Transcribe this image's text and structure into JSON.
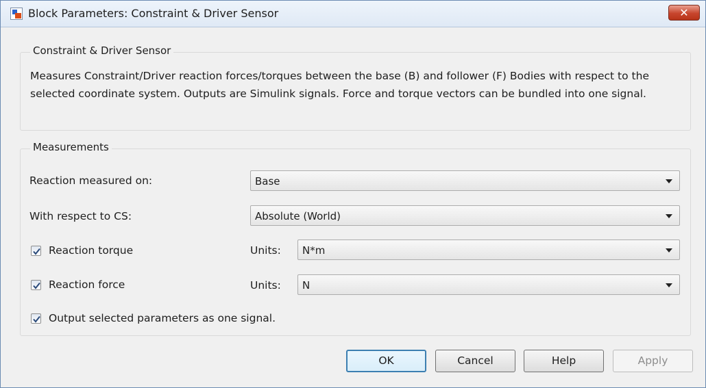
{
  "window": {
    "title": "Block Parameters: Constraint & Driver Sensor",
    "close_label": "✕"
  },
  "description_group": {
    "title": "Constraint & Driver Sensor",
    "text": "Measures Constraint/Driver reaction forces/torques between the base (B) and follower (F) Bodies with respect to the selected coordinate system. Outputs are Simulink signals. Force and torque vectors can be bundled into one signal."
  },
  "measurements": {
    "title": "Measurements",
    "reaction_measured_on": {
      "label": "Reaction measured on:",
      "value": "Base"
    },
    "with_respect_to_cs": {
      "label": "With respect to CS:",
      "value": "Absolute (World)"
    },
    "reaction_torque": {
      "label": "Reaction torque",
      "checked": true,
      "units_label": "Units:",
      "units_value": "N*m"
    },
    "reaction_force": {
      "label": "Reaction force",
      "checked": true,
      "units_label": "Units:",
      "units_value": "N"
    },
    "one_signal": {
      "label": "Output selected parameters as one signal.",
      "checked": true
    }
  },
  "buttons": {
    "ok": "OK",
    "cancel": "Cancel",
    "help": "Help",
    "apply": "Apply"
  },
  "colors": {
    "window_bg": "#f0f0f0",
    "close_button": "#c7452d",
    "default_button_border": "#3c7fb1"
  }
}
